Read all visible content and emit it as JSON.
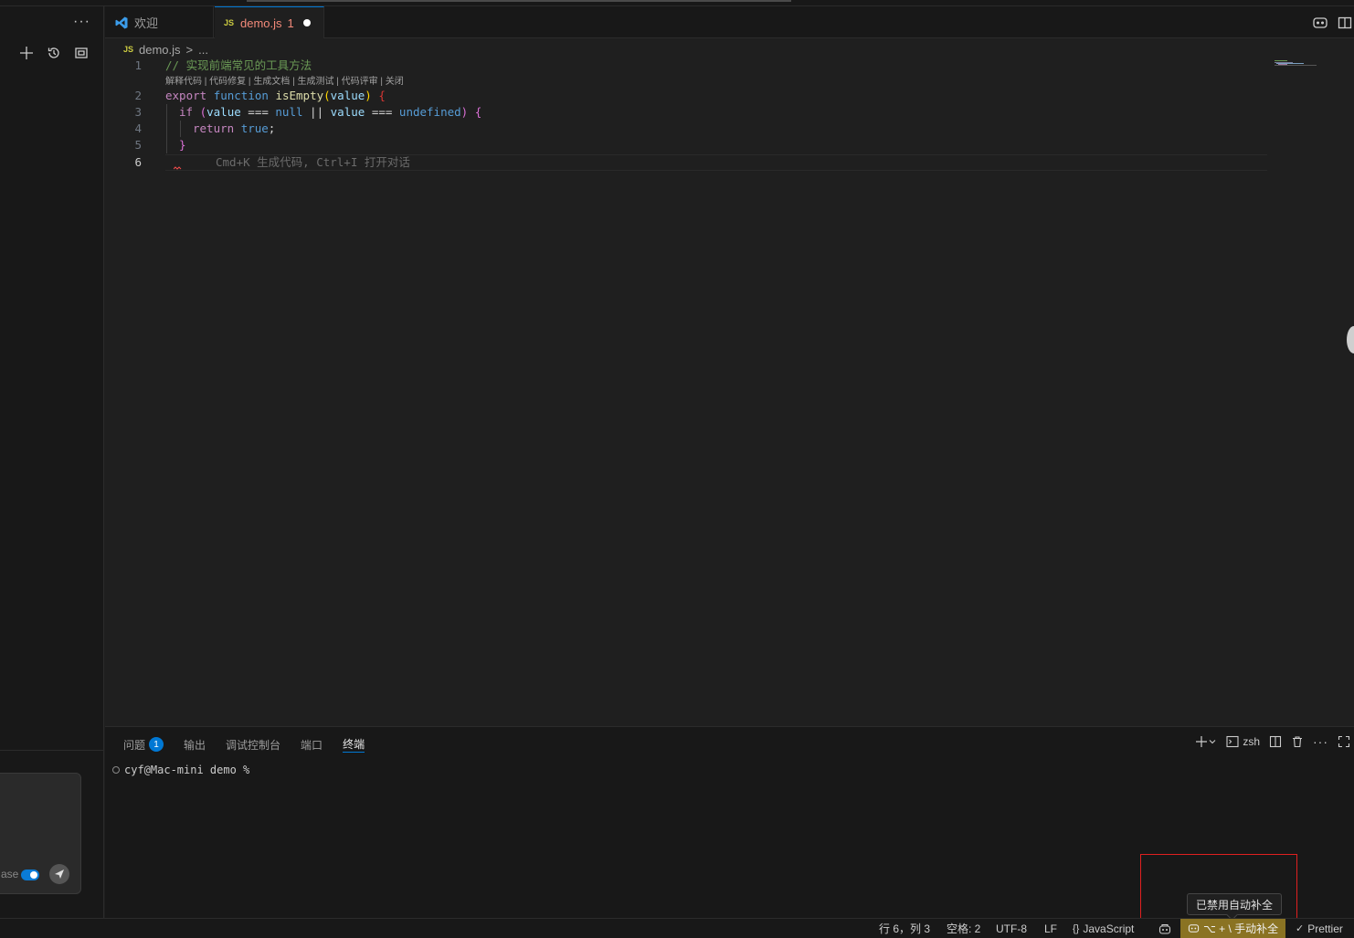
{
  "tabs": {
    "welcome_label": "欢迎",
    "file_label": "demo.js",
    "file_problems": "1",
    "file_icon_text": "JS"
  },
  "breadcrumb": {
    "icon_text": "JS",
    "file": "demo.js",
    "separator": ">",
    "rest": "..."
  },
  "editor": {
    "line_numbers": [
      "1",
      "2",
      "3",
      "4",
      "5",
      "6"
    ],
    "line1": "// 实现前端常见的工具方法",
    "codelens": [
      "解释代码",
      "代码修复",
      "生成文档",
      "生成测试",
      "代码评审",
      "关闭"
    ],
    "codelens_sep": " | ",
    "ghost_hint": "Cmd+K 生成代码, Ctrl+I 打开对话",
    "tokens": {
      "export": "export",
      "function": "function",
      "fn_name": "isEmpty",
      "param": "value",
      "if": "if",
      "null": "null",
      "undefined": "undefined",
      "return": "return",
      "true": "true",
      "strict_eq": "===",
      "or": "||"
    }
  },
  "panel": {
    "tabs": {
      "problems": "问题",
      "problems_count": "1",
      "output": "输出",
      "debug_console": "调试控制台",
      "ports": "端口",
      "terminal": "终端"
    },
    "shell_label": "zsh",
    "prompt": "cyf@Mac-mini demo %"
  },
  "sidebar": {
    "chat_partial_text": "ase"
  },
  "tooltip": "已禁用自动补全",
  "statusbar": {
    "position": "行 6，列 3",
    "indent": "空格: 2",
    "encoding": "UTF-8",
    "eol": "LF",
    "language_icon": "{}",
    "language": "JavaScript",
    "completion": "⌥ + \\ 手动补全",
    "prettier": "Prettier"
  },
  "colors": {
    "accent": "#0078d4",
    "editor_bg": "#1f1f1f",
    "warning_item_bg": "#8a7323",
    "highlight_box": "#e02020"
  }
}
